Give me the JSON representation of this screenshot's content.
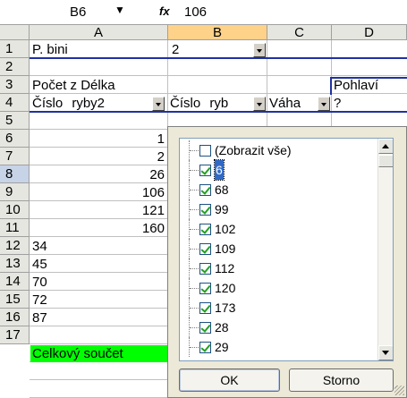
{
  "formula_bar": {
    "name_box": "B6",
    "fx_label": "fx",
    "value": "106"
  },
  "columns": [
    "A",
    "B",
    "C",
    "D"
  ],
  "active_column": "B",
  "rows": [
    "1",
    "2",
    "3",
    "4",
    "5",
    "6",
    "7",
    "8",
    "9",
    "10",
    "11",
    "12",
    "13",
    "14",
    "15",
    "16",
    "17"
  ],
  "selected_row": "8",
  "cells": {
    "a1": "P. bini",
    "b1": "2",
    "a3": "Počet z Délka",
    "d3": "Pohlaví",
    "a4": "Číslo    ryby2",
    "b4": "Číslo    ryb",
    "c4": "Váha",
    "d4": "?",
    "a5": "1",
    "a6": "2",
    "a7": "26",
    "a8": "106",
    "a9": "121",
    "a10": "160",
    "a11": "34",
    "a12": "45",
    "a13": "70",
    "a14": "72",
    "a15": "87",
    "a16": "Celkový součet"
  },
  "colors": {
    "grand_total_bg": "#00ff00",
    "pivot_border": "#2032a0",
    "focus_bg": "#316ac5"
  },
  "filter_popup": {
    "items": [
      {
        "label": "(Zobrazit vše)",
        "checked": false
      },
      {
        "label": "6",
        "checked": true,
        "focused": true
      },
      {
        "label": "68",
        "checked": true
      },
      {
        "label": "99",
        "checked": true
      },
      {
        "label": "102",
        "checked": true
      },
      {
        "label": "109",
        "checked": true
      },
      {
        "label": "112",
        "checked": true
      },
      {
        "label": "120",
        "checked": true
      },
      {
        "label": "173",
        "checked": true
      },
      {
        "label": "28",
        "checked": true
      },
      {
        "label": "29",
        "checked": true
      }
    ],
    "ok_label": "OK",
    "cancel_label": "Storno"
  }
}
